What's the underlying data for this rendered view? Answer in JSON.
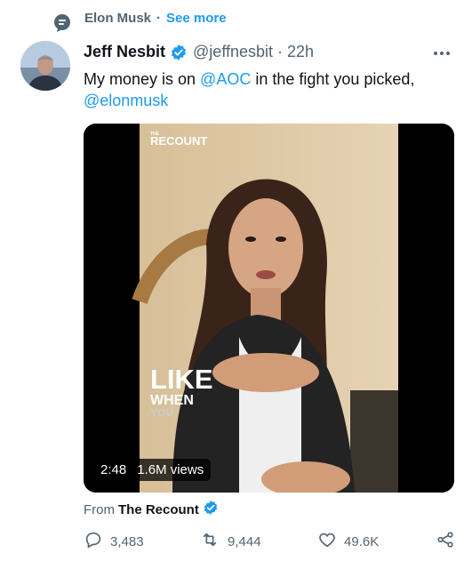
{
  "social_context": {
    "icon": "speech-bubble-icon",
    "name": "Elon Musk",
    "separator": "·",
    "see_more": "See more"
  },
  "tweet": {
    "author_name": "Jeff Nesbit",
    "verified": true,
    "handle": "@jeffnesbit",
    "separator": "·",
    "time": "22h",
    "text_part1": "My money is on ",
    "mention1": "@AOC",
    "text_part2": " in the fight you picked,",
    "mention2": "@elonmusk"
  },
  "media": {
    "logo_small": "THE",
    "logo": "RECOUNT",
    "caption_line1": "LIKE",
    "caption_line2": "WHEN",
    "caption_line3": "YOU",
    "duration": "2:48",
    "views": "1.6M views"
  },
  "source": {
    "prefix": "From",
    "name": "The Recount",
    "verified": true
  },
  "actions": {
    "replies": "3,483",
    "retweets": "9,444",
    "likes": "49.6K"
  },
  "colors": {
    "accent": "#1d9bf0",
    "secondary_text": "#536471",
    "primary_text": "#0f1419"
  }
}
